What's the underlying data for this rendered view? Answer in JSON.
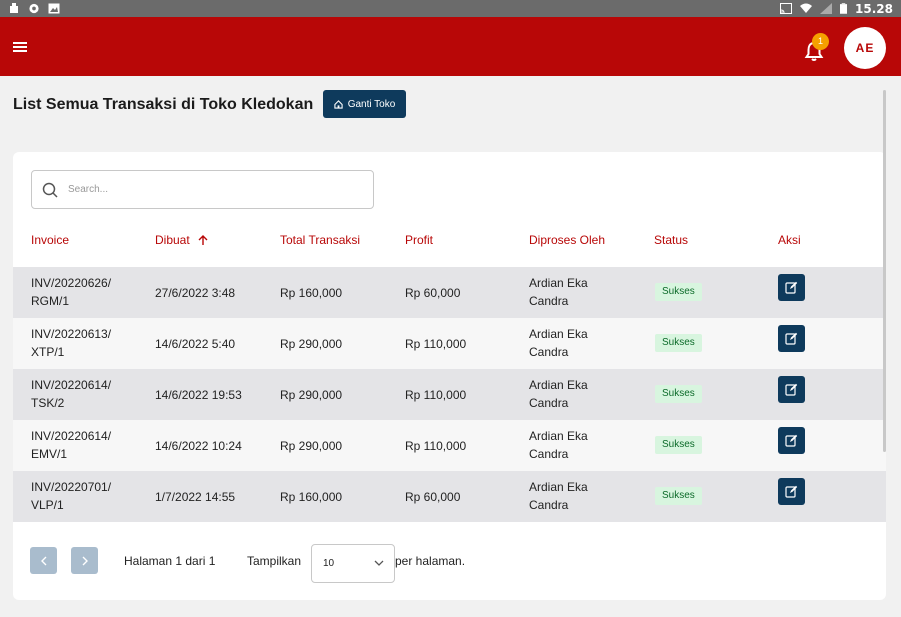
{
  "status_bar": {
    "time": "15.28"
  },
  "header": {
    "notification_count": "1",
    "avatar_initials": "AE"
  },
  "page": {
    "title": "List Semua Transaksi di Toko Kledokan",
    "ganti_toko_label": "Ganti Toko"
  },
  "search": {
    "placeholder": "Search..."
  },
  "table": {
    "columns": [
      "Invoice",
      "Dibuat",
      "Total Transaksi",
      "Profit",
      "Diproses Oleh",
      "Status",
      "Aksi"
    ],
    "rows": [
      {
        "invoice_l1": "INV/20220626/",
        "invoice_l2": "RGM/1",
        "dibuat": "27/6/2022 3:48",
        "total": "Rp 160,000",
        "profit": "Rp 60,000",
        "by_l1": "Ardian Eka",
        "by_l2": "Candra",
        "status": "Sukses"
      },
      {
        "invoice_l1": "INV/20220613/",
        "invoice_l2": "XTP/1",
        "dibuat": "14/6/2022 5:40",
        "total": "Rp 290,000",
        "profit": "Rp 110,000",
        "by_l1": "Ardian Eka",
        "by_l2": "Candra",
        "status": "Sukses"
      },
      {
        "invoice_l1": "INV/20220614/",
        "invoice_l2": "TSK/2",
        "dibuat": "14/6/2022 19:53",
        "total": "Rp 290,000",
        "profit": "Rp 110,000",
        "by_l1": "Ardian Eka",
        "by_l2": "Candra",
        "status": "Sukses"
      },
      {
        "invoice_l1": "INV/20220614/",
        "invoice_l2": "EMV/1",
        "dibuat": "14/6/2022 10:24",
        "total": "Rp 290,000",
        "profit": "Rp 110,000",
        "by_l1": "Ardian Eka",
        "by_l2": "Candra",
        "status": "Sukses"
      },
      {
        "invoice_l1": "INV/20220701/",
        "invoice_l2": "VLP/1",
        "dibuat": "1/7/2022 14:55",
        "total": "Rp 160,000",
        "profit": "Rp 60,000",
        "by_l1": "Ardian Eka",
        "by_l2": "Candra",
        "status": "Sukses"
      }
    ]
  },
  "pagination": {
    "page_info": "Halaman 1 dari 1",
    "show_label": "Tampilkan",
    "per_page_value": "10",
    "per_page_suffix": "per halaman."
  },
  "colors": {
    "brand": "#b80707",
    "button": "#0e3a5c",
    "success_bg": "#d8f5df",
    "badge": "#f5a000"
  }
}
